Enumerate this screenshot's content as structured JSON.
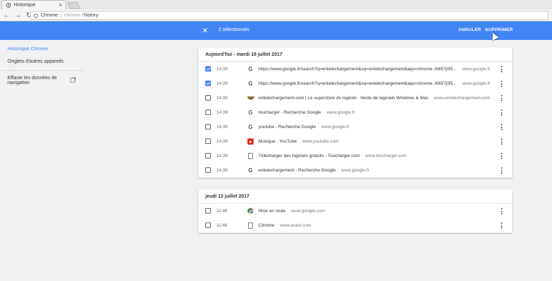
{
  "tab": {
    "title": "Historique",
    "close": "×"
  },
  "toolbar": {
    "back": "←",
    "forward": "→",
    "reload": "↻",
    "chip": "Chrome",
    "url_scheme": "chrome://",
    "url_path": "history"
  },
  "selection": {
    "close": "✕",
    "count": "2 sélectionnés",
    "cancel": "ANNULER",
    "delete": "SUPPRIMER"
  },
  "sidebar": {
    "items": [
      "Historique Chrome",
      "Onglets d'autres appareils"
    ],
    "clear_line1": "Effacer les données de",
    "clear_line2": "navigation"
  },
  "groups": [
    {
      "date": "Aujourd'hui - mardi 18 juillet 2017",
      "entries": [
        {
          "checked": true,
          "time": "14:39",
          "icon": "google",
          "title": "https://www.google.fr/search?q=entelechargement&oq=entelechargement&aqs=chrome..69i57j0l5...",
          "domain": "www.google.fr"
        },
        {
          "checked": true,
          "time": "14:39",
          "icon": "google",
          "title": "https://www.google.fr/search?q=entelechargement&oq=entelechargement&aqs=chrome..69i57j0l5...",
          "domain": "www.google.fr"
        },
        {
          "checked": false,
          "time": "14:39",
          "icon": "entelechargement",
          "title": "entelechargement.com | Le superstore du logiciel - Vente de logiciels Windows & Mac",
          "domain": "www.entelechargement.com"
        },
        {
          "checked": false,
          "time": "14:39",
          "icon": "google",
          "title": "toucharger - Recherche Google",
          "domain": "www.google.fr"
        },
        {
          "checked": false,
          "time": "14:39",
          "icon": "google",
          "title": "youtube - Recherche Google",
          "domain": "www.google.fr"
        },
        {
          "checked": false,
          "time": "14:39",
          "icon": "youtube",
          "title": "Musique - YouTube",
          "domain": "www.youtube.com"
        },
        {
          "checked": false,
          "time": "14:39",
          "icon": "document",
          "title": "Télécharger des logiciels gratuits - Toucharger.com",
          "domain": "www.toucharger.com"
        },
        {
          "checked": false,
          "time": "14:38",
          "icon": "google",
          "title": "entelechargement - Recherche Google",
          "domain": "www.google.fr"
        }
      ]
    },
    {
      "date": "jeudi 13 juillet 2017",
      "entries": [
        {
          "checked": false,
          "time": "11:46",
          "icon": "chrome",
          "title": "Mise en route",
          "domain": "www.google.com"
        },
        {
          "checked": false,
          "time": "11:46",
          "icon": "document",
          "title": "Chrome",
          "domain": "www.avast.com"
        }
      ]
    }
  ],
  "colors": {
    "accent": "#4285f4",
    "background": "#f1f1f1"
  }
}
